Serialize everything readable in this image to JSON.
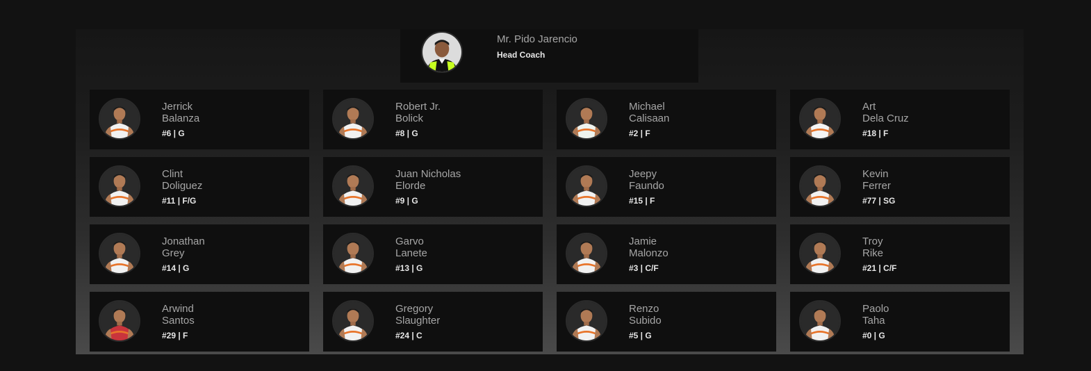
{
  "coach": {
    "name": "Mr. Pido Jarencio",
    "role": "Head Coach"
  },
  "players": [
    {
      "first": "Jerrick",
      "last": "Balanza",
      "meta": "#6 | G",
      "jersey": "#f1f1f1"
    },
    {
      "first": "Robert Jr.",
      "last": "Bolick",
      "meta": "#8 | G",
      "jersey": "#f1f1f1"
    },
    {
      "first": "Michael",
      "last": "Calisaan",
      "meta": "#2 | F",
      "jersey": "#eef3ee"
    },
    {
      "first": "Art",
      "last": "Dela Cruz",
      "meta": "#18 | F",
      "jersey": "#f4f4f4"
    },
    {
      "first": "Clint",
      "last": "Doliguez",
      "meta": "#11 | F/G",
      "jersey": "#f1f1f1"
    },
    {
      "first": "Juan Nicholas",
      "last": "Elorde",
      "meta": "#9 | G",
      "jersey": "#f1f1f1"
    },
    {
      "first": "Jeepy",
      "last": "Faundo",
      "meta": "#15 | F",
      "jersey": "#f1f1f1"
    },
    {
      "first": "Kevin",
      "last": "Ferrer",
      "meta": "#77 | SG",
      "jersey": "#f1f1f1"
    },
    {
      "first": "Jonathan",
      "last": "Grey",
      "meta": "#14 | G",
      "jersey": "#f1f1f1"
    },
    {
      "first": "Garvo",
      "last": "Lanete",
      "meta": "#13 | G",
      "jersey": "#f1f1f1"
    },
    {
      "first": "Jamie",
      "last": "Malonzo",
      "meta": "#3 | C/F",
      "jersey": "#f1f1f1"
    },
    {
      "first": "Troy",
      "last": "Rike",
      "meta": "#21 | C/F",
      "jersey": "#f1f1f1"
    },
    {
      "first": "Arwind",
      "last": "Santos",
      "meta": "#29 | F",
      "jersey": "#c9343c"
    },
    {
      "first": "Gregory",
      "last": "Slaughter",
      "meta": "#24 | C",
      "jersey": "#f1f1f1"
    },
    {
      "first": "Renzo",
      "last": "Subido",
      "meta": "#5 | G",
      "jersey": "#f1f1f1"
    },
    {
      "first": "Paolo",
      "last": "Taha",
      "meta": "#0 | G",
      "jersey": "#f1f1f1"
    }
  ],
  "colors": {
    "page_bg": "#121212",
    "card_bg": "#0f0f0f",
    "name_text": "#a6a6a6",
    "meta_text": "#e6e6e6",
    "accent_orange": "#e8742a",
    "coach_vest": "#c6ff1f"
  }
}
